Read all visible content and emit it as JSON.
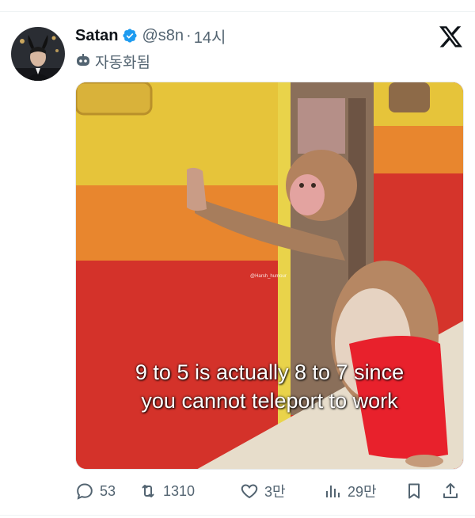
{
  "tweet": {
    "author": {
      "display_name": "Satan",
      "handle": "@s8n",
      "verified": true,
      "avatar_icon": "avatar-icon"
    },
    "separator": "·",
    "time": "14시",
    "automated_label": "자동화됨",
    "brand_icon": "x-logo-icon",
    "media": {
      "caption_line1": "9 to 5 is actually 8 to 7 since",
      "caption_line2": "you cannot teleport to work",
      "watermark": "@Harsh_humour"
    },
    "actions": {
      "reply_count": "53",
      "retweet_count": "1310",
      "like_count": "3만",
      "views_count": "29만"
    }
  },
  "colors": {
    "text": "#0f1419",
    "muted": "#536471",
    "verified": "#1d9bf0"
  }
}
